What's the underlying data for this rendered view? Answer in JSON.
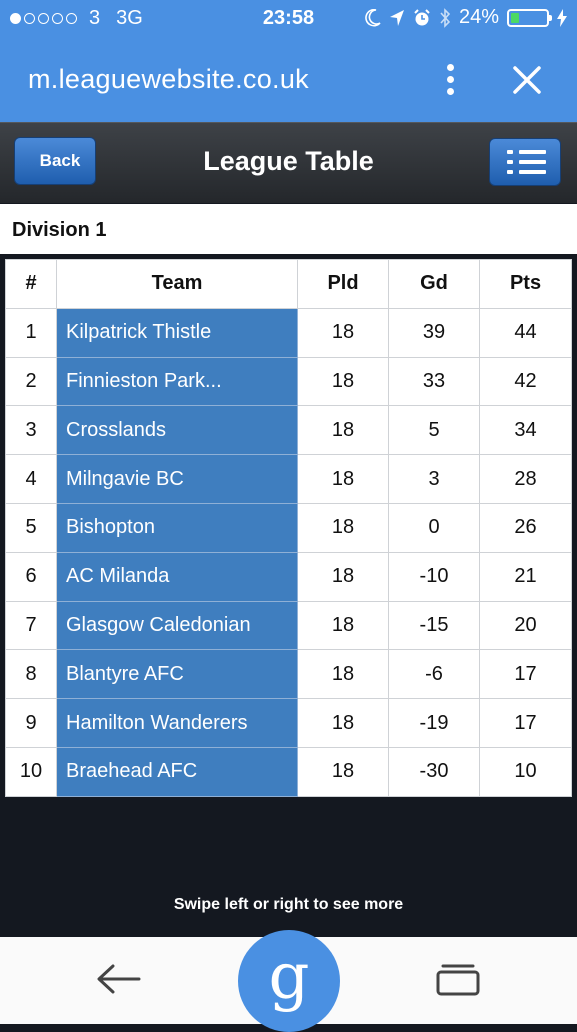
{
  "status": {
    "carrier": "3",
    "network": "3G",
    "time": "23:58",
    "battery": "24%",
    "signal_dots_filled": 1,
    "signal_dots_total": 5,
    "battery_level": 0.24
  },
  "browser": {
    "url": "m.leaguewebsite.co.uk",
    "menu_icon": "kebab-menu-icon",
    "close_icon": "close-icon"
  },
  "header": {
    "back_label": "Back",
    "title": "League Table",
    "menu_icon": "list-menu-icon"
  },
  "division": "Division 1",
  "table": {
    "columns": [
      "#",
      "Team",
      "Pld",
      "Gd",
      "Pts"
    ],
    "rows": [
      {
        "pos": "1",
        "team": "Kilpatrick Thistle",
        "pld": "18",
        "gd": "39",
        "pts": "44"
      },
      {
        "pos": "2",
        "team": "Finnieston Park...",
        "pld": "18",
        "gd": "33",
        "pts": "42"
      },
      {
        "pos": "3",
        "team": "Crosslands",
        "pld": "18",
        "gd": "5",
        "pts": "34"
      },
      {
        "pos": "4",
        "team": "Milngavie BC",
        "pld": "18",
        "gd": "3",
        "pts": "28"
      },
      {
        "pos": "5",
        "team": "Bishopton",
        "pld": "18",
        "gd": "0",
        "pts": "26"
      },
      {
        "pos": "6",
        "team": "AC Milanda",
        "pld": "18",
        "gd": "-10",
        "pts": "21"
      },
      {
        "pos": "7",
        "team": "Glasgow Caledonian",
        "pld": "18",
        "gd": "-15",
        "pts": "20"
      },
      {
        "pos": "8",
        "team": "Blantyre AFC",
        "pld": "18",
        "gd": "-6",
        "pts": "17"
      },
      {
        "pos": "9",
        "team": "Hamilton Wanderers",
        "pld": "18",
        "gd": "-19",
        "pts": "17"
      },
      {
        "pos": "10",
        "team": "Braehead AFC",
        "pld": "18",
        "gd": "-30",
        "pts": "10"
      }
    ]
  },
  "hint": "Swipe left or right to see more",
  "bottom_nav": {
    "back_icon": "arrow-left-icon",
    "home_icon": "google-icon",
    "home_glyph": "g",
    "recents_icon": "recent-tabs-icon"
  },
  "colors": {
    "brand_blue": "#4a90e2",
    "team_cell": "#3f7ebf",
    "button_blue": "#2f6fc0",
    "header_dark": "#2c2f33",
    "battery_green": "#4cd964"
  }
}
